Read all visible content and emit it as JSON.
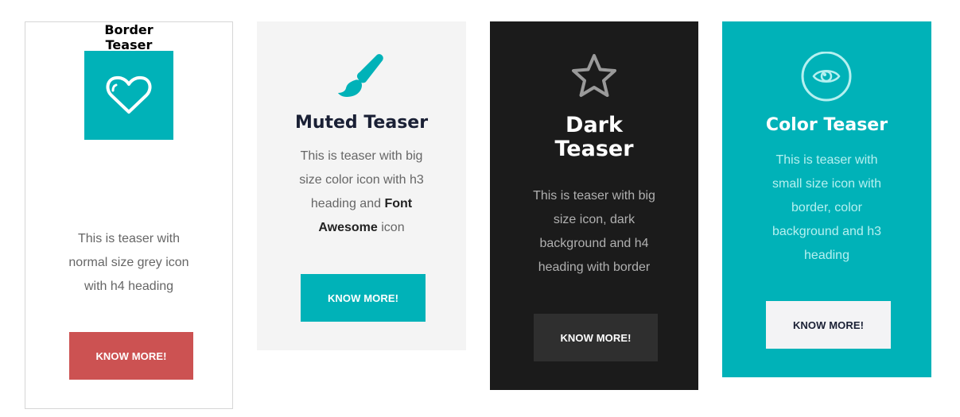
{
  "colors": {
    "accent": "#00b2b8",
    "danger": "#cc5252",
    "dark_bg": "#1b1b1b",
    "muted_bg": "#f4f4f4",
    "heading": "#1a2035"
  },
  "cards": [
    {
      "variant": "border",
      "icon": "heart-icon",
      "heading_line1": "Border",
      "heading_line2": "Teaser",
      "text": "This is teaser with normal size grey icon with h4 heading",
      "button_label": "KNOW MORE!"
    },
    {
      "variant": "muted",
      "icon": "paint-brush-icon",
      "heading": "Muted Teaser",
      "text_before": "This is teaser with big size color icon with h3 heading and ",
      "text_bold": "Font Awesome",
      "text_after": " icon",
      "button_label": "KNOW MORE!"
    },
    {
      "variant": "dark",
      "icon": "star-icon",
      "heading_line1": "Dark",
      "heading_line2": "Teaser",
      "text": "This is teaser with big size icon, dark background and h4 heading with border",
      "button_label": "KNOW MORE!"
    },
    {
      "variant": "color",
      "icon": "eye-icon",
      "heading": "Color Teaser",
      "text": "This is teaser with small size icon with border, color background and h3 heading",
      "button_label": "KNOW MORE!"
    }
  ]
}
